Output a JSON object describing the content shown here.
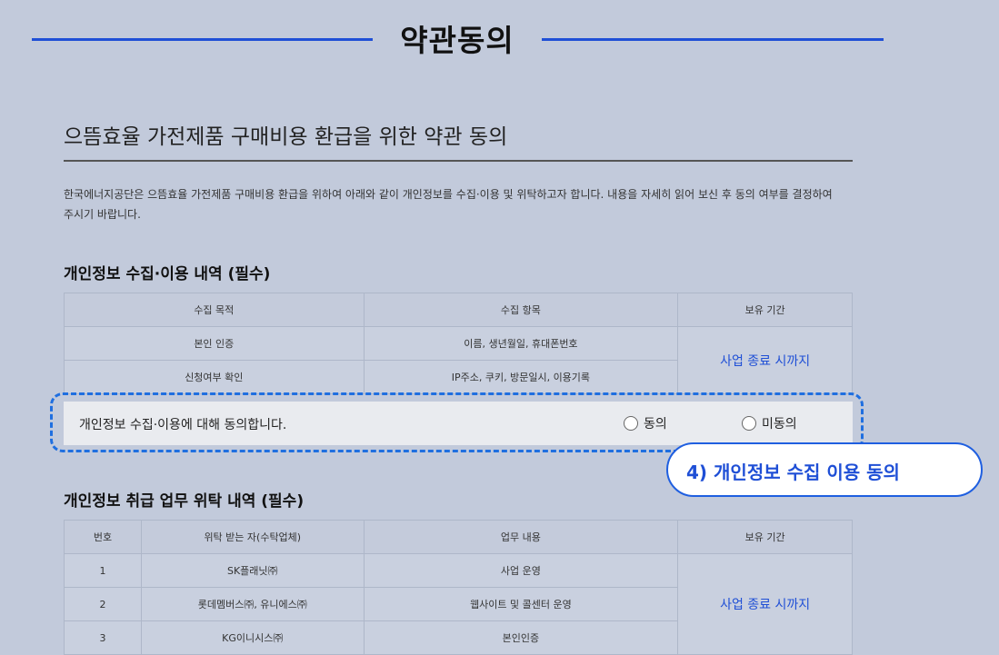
{
  "header": {
    "title": "약관동의"
  },
  "section": {
    "title": "으뜸효율 가전제품 구매비용 환급을 위한 약관 동의",
    "intro": "한국에너지공단은 으뜸효율 가전제품 구매비용 환급을 위하여 아래와 같이 개인정보를 수집·이용 및 위탁하고자 합니다. 내용을 자세히 읽어 보신 후 동의 여부를 결정하여 주시기 바랍니다."
  },
  "collection": {
    "heading": "개인정보 수집·이용 내역 (필수)",
    "columns": [
      "수집 목적",
      "수집 항목",
      "보유 기간"
    ],
    "rows": [
      [
        "본인 인증",
        "이름, 생년월일, 휴대폰번호"
      ],
      [
        "신청여부 확인",
        "IP주소, 쿠키, 방문일시, 이용기록"
      ]
    ],
    "retention": "사업 종료 시까지"
  },
  "consent": {
    "text": "개인정보 수집·이용에 대해 동의합니다.",
    "agree_label": "동의",
    "disagree_label": "미동의"
  },
  "callout": {
    "label": "4) 개인정보 수집 이용 동의"
  },
  "outsourcing": {
    "heading": "개인정보 취급 업무 위탁 내역 (필수)",
    "columns": [
      "번호",
      "위탁 받는 자(수탁업체)",
      "업무 내용",
      "보유 기간"
    ],
    "rows": [
      [
        "1",
        "SK플래닛㈜",
        "사업 운영"
      ],
      [
        "2",
        "롯데멤버스㈜, 유니에스㈜",
        "웹사이트 및 콜센터 운영"
      ],
      [
        "3",
        "KG이니시스㈜",
        "본인인증"
      ]
    ],
    "retention": "사업 종료 시까지"
  }
}
